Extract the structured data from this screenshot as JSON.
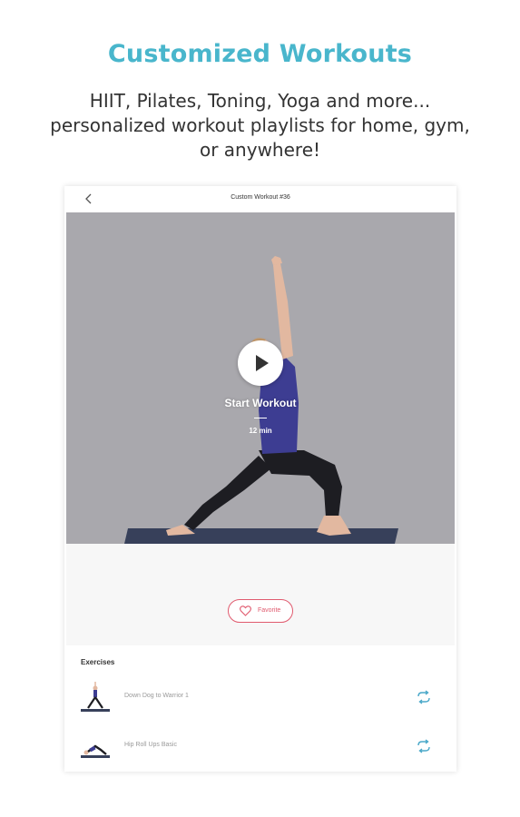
{
  "promo": {
    "title": "Customized Workouts",
    "subtitle_line1": "HIIT, Pilates, Toning, Yoga and more...",
    "subtitle_line2": "personalized workout playlists for home, gym,",
    "subtitle_line3": "or anywhere!"
  },
  "app": {
    "header_title": "Custom Workout #36",
    "hero": {
      "start_label": "Start Workout",
      "duration": "12 min"
    },
    "favorite_label": "Favorite",
    "exercises_header": "Exercises",
    "exercises": [
      {
        "name": "Down Dog to Warrior 1",
        "icon": "yoga-pose-thumbnail"
      },
      {
        "name": "Hip Roll Ups Basic",
        "icon": "floor-exercise-thumbnail"
      }
    ]
  },
  "colors": {
    "accent": "#49b6cc",
    "favorite": "#e05a6e",
    "repeat": "#4aa8c9"
  }
}
